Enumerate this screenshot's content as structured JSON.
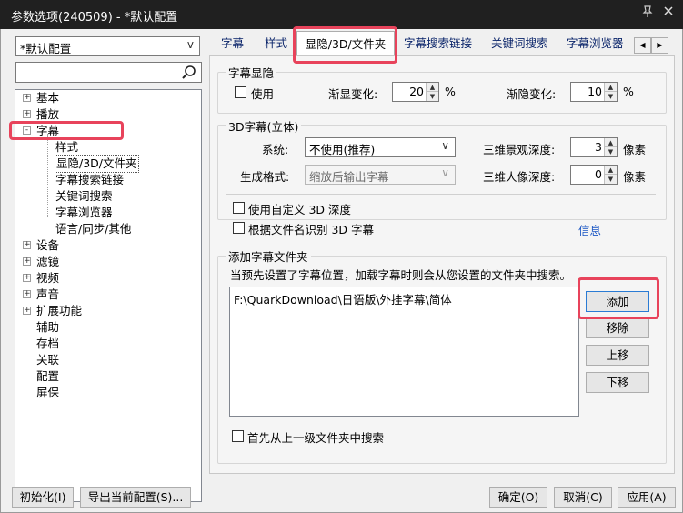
{
  "window": {
    "title": "参数选项(240509) - *默认配置",
    "pin_icon": "pin-icon",
    "close_icon": "close-icon"
  },
  "profile": {
    "value": "*默认配置",
    "arrow": "v"
  },
  "search": {
    "value": "",
    "icon": "search-icon"
  },
  "tree": {
    "items": [
      {
        "label": "基本",
        "expander": "+"
      },
      {
        "label": "播放",
        "expander": "+"
      },
      {
        "label": "字幕",
        "expander": "-"
      },
      {
        "label": "样式"
      },
      {
        "label": "显隐/3D/文件夹"
      },
      {
        "label": "字幕搜索链接"
      },
      {
        "label": "关键词搜索"
      },
      {
        "label": "字幕浏览器"
      },
      {
        "label": "语言/同步/其他"
      },
      {
        "label": "设备",
        "expander": "+"
      },
      {
        "label": "滤镜",
        "expander": "+"
      },
      {
        "label": "视频",
        "expander": "+"
      },
      {
        "label": "声音",
        "expander": "+"
      },
      {
        "label": "扩展功能",
        "expander": "+"
      },
      {
        "label": "辅助"
      },
      {
        "label": "存档"
      },
      {
        "label": "关联"
      },
      {
        "label": "配置"
      },
      {
        "label": "屏保"
      }
    ]
  },
  "tabs": {
    "items": [
      "字幕",
      "样式",
      "显隐/3D/文件夹",
      "字幕搜索链接",
      "关键词搜索",
      "字幕浏览器"
    ],
    "active_index": 2,
    "scroll_left": "◀",
    "scroll_right": "▶"
  },
  "visibility": {
    "group_label": "字幕显隐",
    "use_label": "使用",
    "use_checked": false,
    "fade_in_label": "渐显变化:",
    "fade_in_value": "20",
    "fade_out_label": "渐隐变化:",
    "fade_out_value": "10",
    "unit": "%"
  },
  "three_d": {
    "group_label": "3D字幕(立体)",
    "system_label": "系统:",
    "system_value": "不使用(推荐)",
    "format_label": "生成格式:",
    "format_value": "缩放后输出字幕",
    "scene_depth_label": "三维景观深度:",
    "scene_depth_value": "3",
    "person_depth_label": "三维人像深度:",
    "person_depth_value": "0",
    "unit": "像素",
    "custom_depth_label": "使用自定义 3D 深度",
    "custom_depth_checked": false,
    "filename_label": "根据文件名识别 3D 字幕",
    "filename_checked": false,
    "info_link": "信息"
  },
  "folders": {
    "group_label": "添加字幕文件夹",
    "description": "当预先设置了字幕位置，加载字幕时则会从您设置的文件夹中搜索。",
    "list": [
      "F:\\QuarkDownload\\日语版\\外挂字幕\\简体"
    ],
    "add_button": "添加",
    "remove_button": "移除",
    "up_button": "上移",
    "down_button": "下移",
    "parent_first_label": "首先从上一级文件夹中搜索",
    "parent_first_checked": false
  },
  "footer": {
    "init_button": "初始化(I)",
    "export_button": "导出当前配置(S)...",
    "ok_button": "确定(O)",
    "cancel_button": "取消(C)",
    "apply_button": "应用(A)"
  },
  "colors": {
    "highlight": "#e8435b",
    "titlebar": "#202020",
    "link": "#1a56c4"
  }
}
